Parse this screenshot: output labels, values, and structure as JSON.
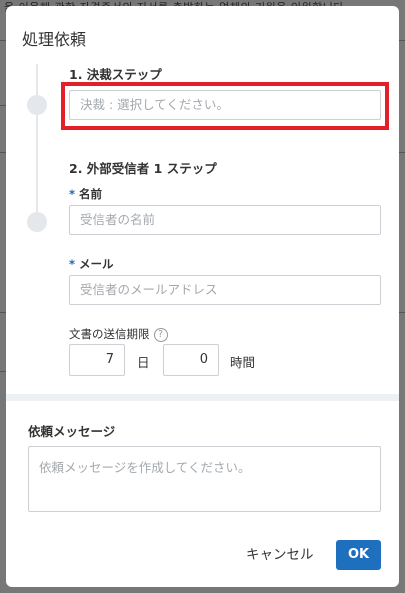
{
  "background": {
    "text": "을 이용해 관한 자격증서의 지서를 충발하는 업체의 기원을 인워합니다"
  },
  "dialog": {
    "title": "処理依頼",
    "step1": {
      "label": "1. 決裁ステップ",
      "placeholder": "決裁 : 選択してください。"
    },
    "step2": {
      "label": "2. 外部受信者 1 ステップ",
      "name_label": "名前",
      "name_placeholder": "受信者の名前",
      "email_label": "メール",
      "email_placeholder": "受信者のメールアドレス",
      "deadline_label": "文書の送信期限",
      "help_glyph": "?",
      "days_value": "7",
      "days_unit": "日",
      "hours_value": "0",
      "hours_unit": "時間"
    },
    "required_mark": "*",
    "message": {
      "label": "依頼メッセージ",
      "placeholder": "依頼メッセージを作成してください。"
    },
    "buttons": {
      "cancel": "キャンセル",
      "ok": "OK"
    }
  },
  "colors": {
    "accent": "#1f6fbf",
    "highlight": "#e3202a",
    "required": "#1b63b8"
  }
}
